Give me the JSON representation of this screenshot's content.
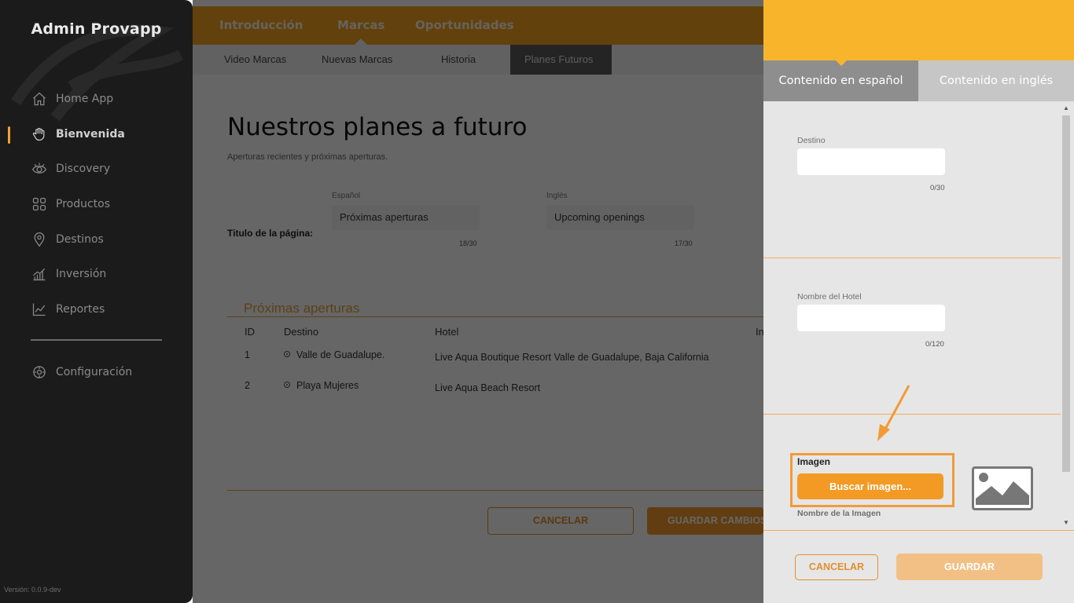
{
  "sidebar": {
    "brand": "Admin Provapp",
    "items": [
      {
        "label": "Home App",
        "icon": "home-icon"
      },
      {
        "label": "Bienvenida",
        "icon": "wave-hand-icon",
        "active": true
      },
      {
        "label": "Discovery",
        "icon": "eye-icon"
      },
      {
        "label": "Productos",
        "icon": "grid-icon"
      },
      {
        "label": "Destinos",
        "icon": "location-pin-icon"
      },
      {
        "label": "Inversión",
        "icon": "bar-chart-icon"
      },
      {
        "label": "Reportes",
        "icon": "line-chart-icon"
      }
    ],
    "settings": {
      "label": "Configuración",
      "icon": "gear-icon"
    },
    "version": "Versión: 0.0.9-dev"
  },
  "main": {
    "top_tabs": [
      "Introducción",
      "Marcas",
      "Oportunidades"
    ],
    "top_tab_active": "Marcas",
    "sub_tabs": [
      "Video Marcas",
      "Nuevas Marcas",
      "Historia",
      "Planes Futuros"
    ],
    "sub_tab_active": "Planes Futuros",
    "title": "Nuestros planes a futuro",
    "subtitle": "Aperturas recientes y próximas aperturas.",
    "page_title_label": "Titulo de la página:",
    "spanish": {
      "label": "Español",
      "value": "Próximas aperturas",
      "count": "18/30"
    },
    "english": {
      "label": "Inglés",
      "value": "Upcoming openings",
      "count": "17/30"
    },
    "section_title": "Próximas aperturas",
    "table": {
      "headers": [
        "ID",
        "Destino",
        "Hotel",
        "In"
      ],
      "rows": [
        {
          "id": "1",
          "destino": "Valle de Guadalupe.",
          "hotel": "Live Aqua Boutique Resort Valle de Guadalupe, Baja California"
        },
        {
          "id": "2",
          "destino": "Playa Mujeres",
          "hotel": "Live Aqua Beach Resort"
        }
      ]
    },
    "cancel_label": "CANCELAR",
    "save_label": "GUARDAR CAMBIOS"
  },
  "panel": {
    "tabs": [
      "Contenido en español",
      "Contenido en inglés"
    ],
    "active_tab": "Contenido en español",
    "destino": {
      "label": "Destino",
      "value": "",
      "count": "0/30"
    },
    "hotel": {
      "label": "Nombre del Hotel",
      "value": "",
      "count": "0/120"
    },
    "image": {
      "label": "Imagen",
      "button": "Buscar imagen...",
      "name_label": "Nombre de la Imagen"
    },
    "cancel_label": "CANCELAR",
    "save_label": "GUARDAR"
  },
  "colors": {
    "accent": "#f5a41e",
    "panel_header": "#f8b52c",
    "highlight": "#f29b37"
  }
}
